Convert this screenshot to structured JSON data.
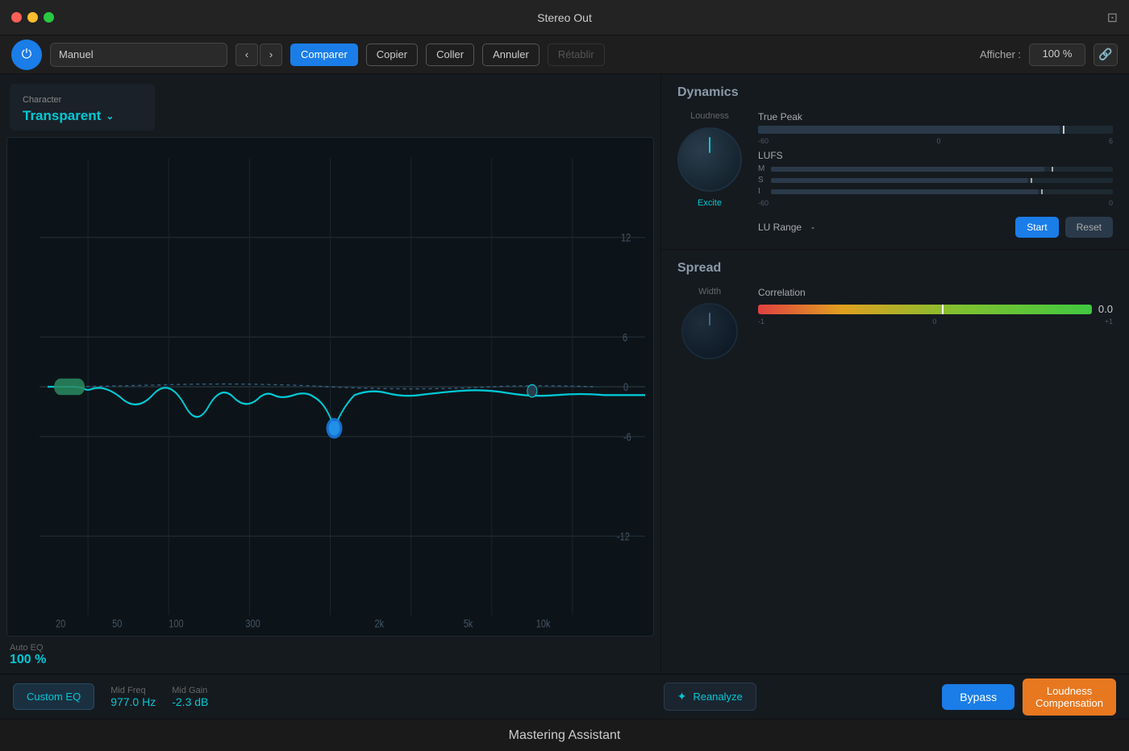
{
  "titlebar": {
    "title": "Stereo Out"
  },
  "toolbar": {
    "preset_value": "Manuel",
    "compare_label": "Comparer",
    "copy_label": "Copier",
    "paste_label": "Coller",
    "undo_label": "Annuler",
    "redo_label": "Rétablir",
    "afficher_label": "Afficher :",
    "zoom_value": "100 %"
  },
  "character": {
    "label": "Character",
    "value": "Transparent"
  },
  "eq": {
    "auto_eq_label": "Auto EQ",
    "auto_eq_value": "100 %",
    "mid_freq_label": "Mid Freq",
    "mid_freq_value": "977.0 Hz",
    "mid_gain_label": "Mid Gain",
    "mid_gain_value": "-2.3 dB",
    "custom_eq_label": "Custom EQ",
    "y_labels": [
      "12",
      "6",
      "0",
      "-6",
      "-12"
    ],
    "x_labels": [
      "20",
      "50",
      "100",
      "300",
      "2k",
      "5k",
      "10k"
    ]
  },
  "dynamics": {
    "title": "Dynamics",
    "loudness_label": "Loudness",
    "excite_label": "Excite",
    "true_peak_label": "True Peak",
    "true_peak_markers": [
      "-60",
      "0",
      "6"
    ],
    "lufs_label": "LUFS",
    "lufs_rows": [
      {
        "label": "M"
      },
      {
        "label": "S"
      },
      {
        "label": "I"
      }
    ],
    "lufs_markers": [
      "-60",
      "0"
    ],
    "lu_range_label": "LU Range",
    "lu_range_value": "-",
    "start_label": "Start",
    "reset_label": "Reset"
  },
  "spread": {
    "title": "Spread",
    "width_label": "Width",
    "correlation_label": "Correlation",
    "correlation_value": "0.0",
    "correlation_markers": [
      "-1",
      "0",
      "+1"
    ]
  },
  "bottom": {
    "reanalyze_label": "Reanalyze",
    "bypass_label": "Bypass",
    "loudness_compensation_label": "Loudness\nCompensation",
    "app_title": "Mastering Assistant"
  }
}
